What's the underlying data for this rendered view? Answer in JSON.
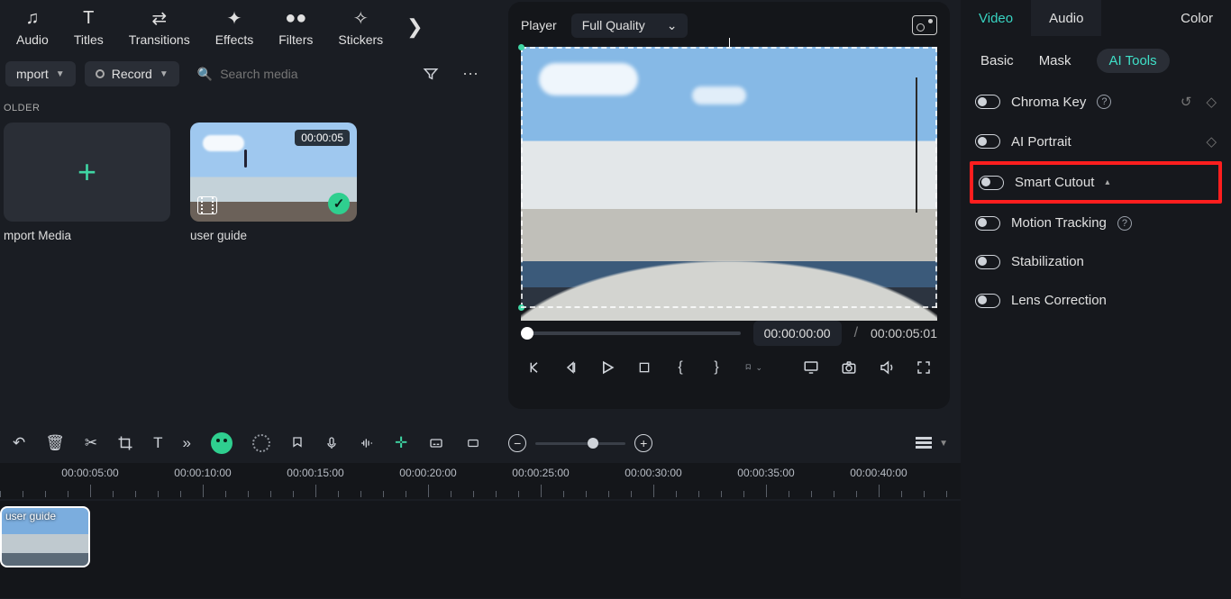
{
  "toolbar": {
    "items": [
      "Audio",
      "Titles",
      "Transitions",
      "Effects",
      "Filters",
      "Stickers"
    ]
  },
  "importBar": {
    "import": "mport",
    "record": "Record",
    "searchPlaceholder": "Search media"
  },
  "media": {
    "folderLabel": "OLDER",
    "cards": [
      {
        "label": "mport Media",
        "type": "add"
      },
      {
        "label": "user guide",
        "type": "clip",
        "duration": "00:00:05"
      }
    ]
  },
  "player": {
    "label": "Player",
    "quality": "Full Quality",
    "current": "00:00:00:00",
    "total": "00:00:05:01"
  },
  "right": {
    "tabs": [
      "Video",
      "Audio",
      "Color"
    ],
    "subtabs": [
      "Basic",
      "Mask",
      "AI Tools"
    ],
    "options": [
      {
        "label": "Chroma Key",
        "help": true,
        "extra": "reset-diamond"
      },
      {
        "label": "AI Portrait",
        "extra": "diamond"
      },
      {
        "label": "Smart Cutout",
        "highlight": true,
        "caret": true
      },
      {
        "label": "Motion Tracking",
        "help": true
      },
      {
        "label": "Stabilization"
      },
      {
        "label": "Lens Correction"
      }
    ]
  },
  "timeline": {
    "labels": [
      "00:00:05:00",
      "00:00:10:00",
      "00:00:15:00",
      "00:00:20:00",
      "00:00:25:00",
      "00:00:30:00",
      "00:00:35:00",
      "00:00:40:00"
    ],
    "clipLabel": "user guide"
  }
}
